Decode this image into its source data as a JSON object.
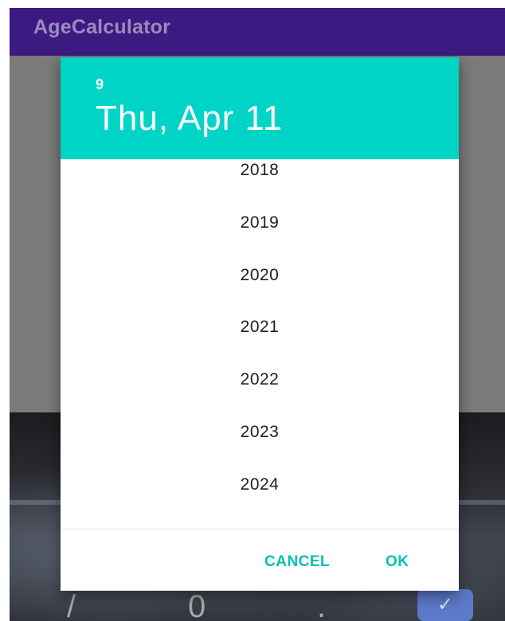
{
  "app": {
    "title": "AgeCalculator"
  },
  "colors": {
    "app_bar": "#3d1a82",
    "dialog_header": "#00d4c6",
    "button_text": "#00c2b5"
  },
  "date_picker": {
    "header_year": "9",
    "header_date": "Thu, Apr 11",
    "years": [
      "2018",
      "2019",
      "2020",
      "2021",
      "2022",
      "2023",
      "2024"
    ],
    "cancel_label": "CANCEL",
    "ok_label": "OK"
  },
  "background": {
    "glyphs": [
      "/",
      "0",
      "."
    ],
    "confirm_icon": "check-icon",
    "confirm_glyph": "✓"
  }
}
